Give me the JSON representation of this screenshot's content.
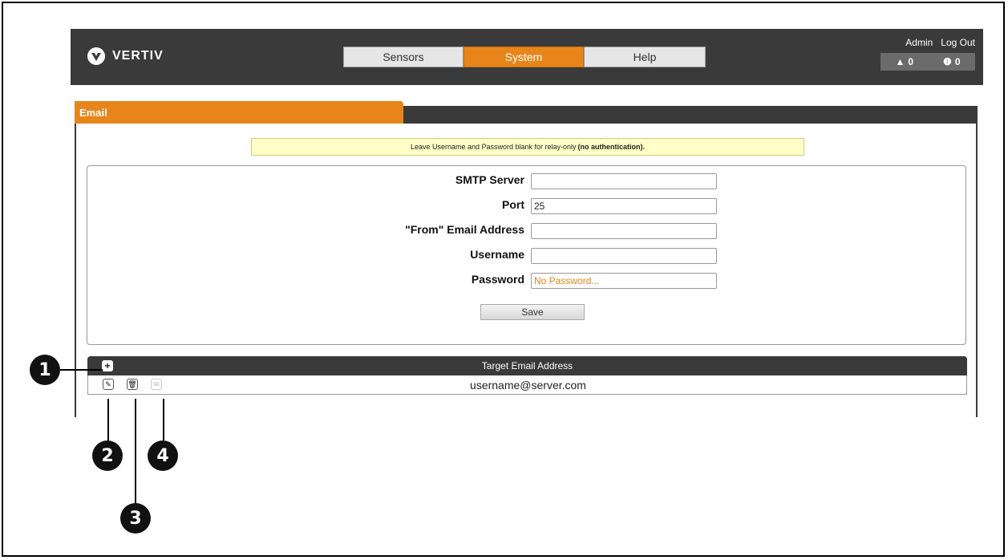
{
  "brand": {
    "name": "VERTIV"
  },
  "nav": {
    "tabs": [
      {
        "label": "Sensors"
      },
      {
        "label": "System"
      },
      {
        "label": "Help"
      }
    ],
    "active": "System"
  },
  "user": {
    "admin_label": "Admin",
    "logout_label": "Log Out",
    "warning_count": "0",
    "alarm_count": "0"
  },
  "panel": {
    "title": "Email"
  },
  "notice": {
    "text": "Leave Username and Password blank for relay-only",
    "bold": "(no authentication)."
  },
  "form": {
    "smtp_label": "SMTP Server",
    "smtp_value": "",
    "port_label": "Port",
    "port_value": "25",
    "from_label": "\"From\" Email Address",
    "from_value": "",
    "username_label": "Username",
    "username_value": "",
    "password_label": "Password",
    "password_placeholder": "No Password...",
    "save_label": "Save"
  },
  "table": {
    "header": "Target Email Address",
    "rows": [
      {
        "address": "username@server.com"
      }
    ]
  },
  "callouts": [
    "1",
    "2",
    "3",
    "4"
  ],
  "colors": {
    "accent": "#e8851a",
    "dark": "#3a3a3a",
    "notice": "#ffffc8"
  }
}
